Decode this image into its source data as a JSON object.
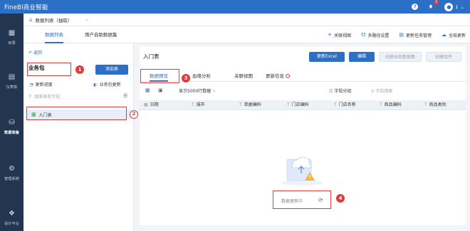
{
  "app": {
    "title": "FineBI商业智能"
  },
  "topbar": {
    "help": "?",
    "notif_count": "1",
    "user": "1"
  },
  "nav": [
    {
      "label": "目录",
      "icon": "grid-icon"
    },
    {
      "label": "仪表板",
      "icon": "dashboard-icon"
    },
    {
      "label": "数据准备",
      "icon": "database-icon"
    },
    {
      "label": "管理系统",
      "icon": "gear-icon"
    },
    {
      "label": "设计平台",
      "icon": "network-icon"
    }
  ],
  "tabs": [
    {
      "label": "数据列表（抽取）"
    }
  ],
  "subtabs": {
    "data_list": "数据列表",
    "user_dataset": "用户自助数据集"
  },
  "toolbar": {
    "relation_view": "关联视图",
    "multipath": "多路径设置",
    "update_manage": "更新任务管理",
    "global_update": "全局更新"
  },
  "left": {
    "back": "返回",
    "package_title": "业务包",
    "add_table": "添加表",
    "update_progress": "更新进度",
    "package_update": "业务包更新",
    "search_placeholder": "搜索表和字段",
    "tree": [
      {
        "label": "入门表"
      }
    ]
  },
  "main": {
    "title": "入门表",
    "buttons": {
      "update_excel": "更新Excel",
      "edit": "编辑",
      "create_dataset": "创建自助数据集",
      "create_component": "创建组件"
    },
    "tabs": {
      "preview": "数据预览",
      "lineage": "血缘分析",
      "relation": "关联视图",
      "update_info": "更新信息"
    },
    "row_limit": "显示5000行数据",
    "field_group": "字段分组",
    "field_search_placeholder": "字段搜索",
    "columns": [
      "日期",
      "城市",
      "单据编码",
      "门店编码",
      "门店名称",
      "商品编码",
      "商品类别"
    ],
    "status": "数据更新中"
  },
  "annotations": [
    "1",
    "2",
    "3",
    "4"
  ],
  "colors": {
    "primary": "#2c6fc7",
    "nav_bg": "#23364f",
    "annotation": "#e23b3b"
  }
}
